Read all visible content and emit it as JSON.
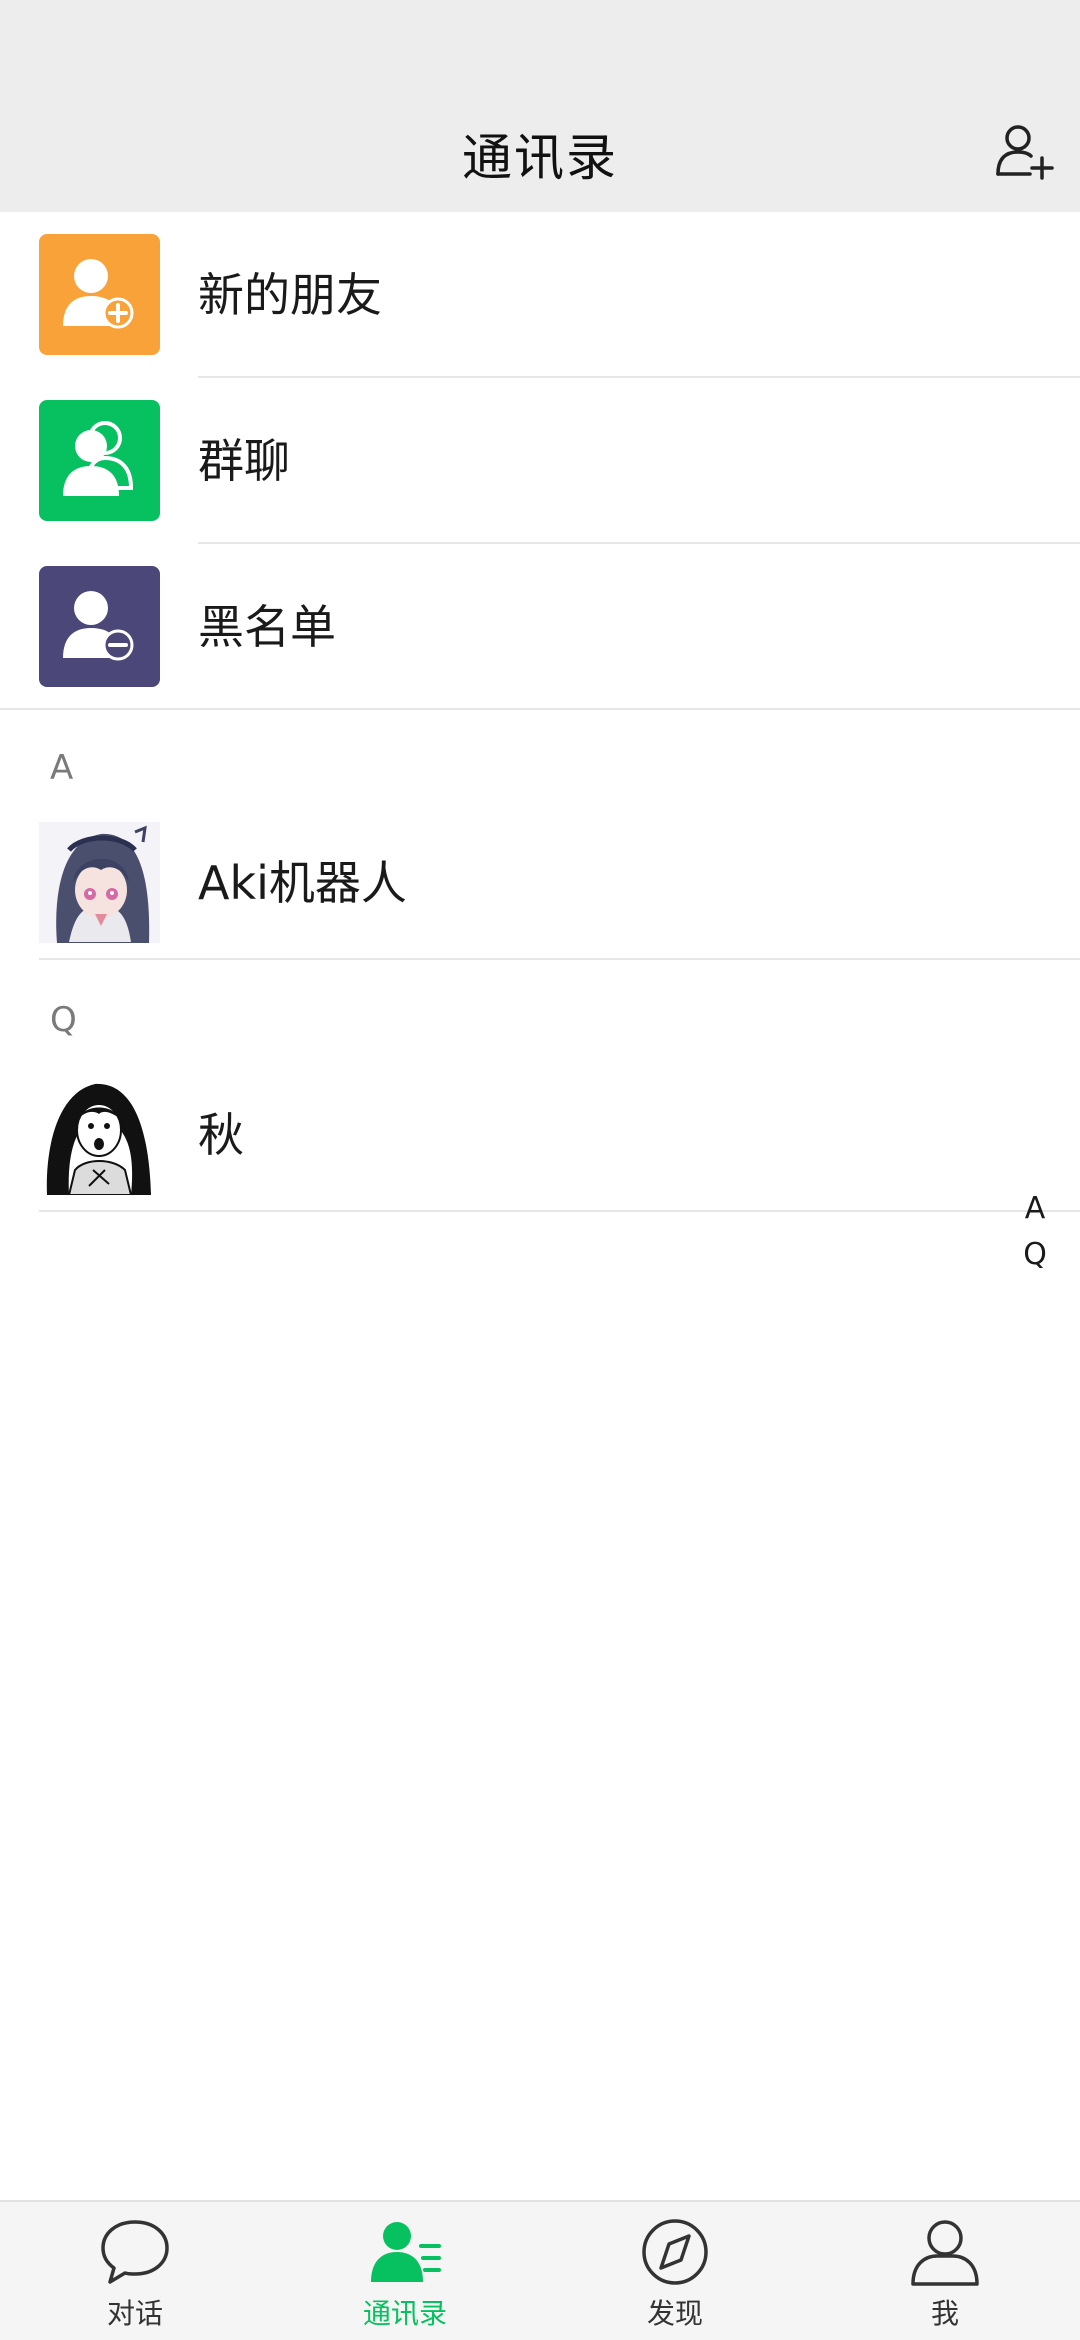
{
  "header": {
    "title": "通讯录",
    "add_icon": "add-contact-icon"
  },
  "functions": [
    {
      "label": "新的朋友",
      "icon": "new-friend-icon",
      "color": "#f9a23a"
    },
    {
      "label": "群聊",
      "icon": "group-chat-icon",
      "color": "#07c160"
    },
    {
      "label": "黑名单",
      "icon": "blacklist-icon",
      "color": "#4b4779"
    }
  ],
  "sections": [
    {
      "letter": "A",
      "contacts": [
        {
          "name": "Aki机器人",
          "avatar": "anime-girl-avatar"
        }
      ]
    },
    {
      "letter": "Q",
      "contacts": [
        {
          "name": "秋",
          "avatar": "manga-girl-avatar"
        }
      ]
    }
  ],
  "index_bar": [
    "A",
    "Q"
  ],
  "bottom_nav": [
    {
      "label": "对话",
      "icon": "chat-bubble-icon",
      "active": false
    },
    {
      "label": "通讯录",
      "icon": "contacts-icon",
      "active": true
    },
    {
      "label": "发现",
      "icon": "compass-icon",
      "active": false
    },
    {
      "label": "我",
      "icon": "profile-icon",
      "active": false
    }
  ],
  "colors": {
    "accent": "#07c160",
    "header_bg": "#ededed",
    "nav_bg": "#f5f5f5"
  }
}
